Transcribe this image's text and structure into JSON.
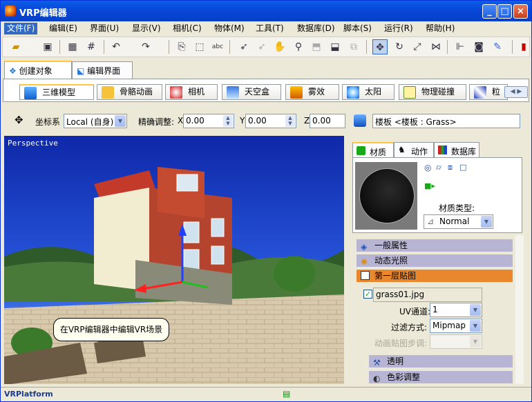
{
  "window": {
    "title": "VRP编辑器",
    "min": "_",
    "max": "□",
    "close": "×"
  },
  "menu": [
    "文件(F)",
    "编辑(E)",
    "界面(U)",
    "显示(V)",
    "相机(C)",
    "物体(M)",
    "工具(T)",
    "数据库(D)",
    "脚本(S)",
    "运行(R)",
    "帮助(H)"
  ],
  "main_tabs": [
    {
      "label": "创建对象",
      "active": true
    },
    {
      "label": "编辑界面",
      "active": false
    }
  ],
  "create_tabs": [
    {
      "label": "三维模型",
      "icon": "cube-icon",
      "active": true
    },
    {
      "label": "骨骼动画",
      "icon": "skeleton-icon"
    },
    {
      "label": "相机",
      "icon": "camera-icon"
    },
    {
      "label": "天空盒",
      "icon": "sky-icon"
    },
    {
      "label": "雾效",
      "icon": "fog-icon"
    },
    {
      "label": "太阳",
      "icon": "sun-icon"
    },
    {
      "label": "物理碰撞",
      "icon": "collision-icon"
    },
    {
      "label": "粒",
      "icon": "particle-icon"
    }
  ],
  "coords": {
    "system_label": "坐标系",
    "system_value": "Local (自身)",
    "precision_label": "精确调整:",
    "x_label": "X",
    "x_value": "0.00",
    "y_label": "Y",
    "y_value": "0.00",
    "z_label": "Z",
    "z_value": "0.00",
    "object_field": "楼板 <楼板 : Grass>"
  },
  "viewport": {
    "label": "Perspective",
    "callout": "在VRP编辑器中编辑VR场景"
  },
  "side_tabs": [
    {
      "label": "材质",
      "active": true
    },
    {
      "label": "动作"
    },
    {
      "label": "数据库"
    }
  ],
  "material": {
    "type_label": "材质类型:",
    "type_value": "Normal"
  },
  "sections": {
    "general": "一般属性",
    "dynamic_light": "动态光照",
    "first_layer": "第一层贴图",
    "transparent": "透明",
    "color_adjust": "色彩调整"
  },
  "texture": {
    "file": "grass01.jpg",
    "uv_label": "UV通道:",
    "uv_value": "1",
    "filter_label": "过滤方式:",
    "filter_value": "Mipmap",
    "anim_label": "动画贴图步调:"
  },
  "status": {
    "left": "VRPlatform"
  },
  "colors": {
    "title_bar": "#0848d8",
    "active_section": "#e8872c",
    "sky": "#1b3fbf"
  }
}
